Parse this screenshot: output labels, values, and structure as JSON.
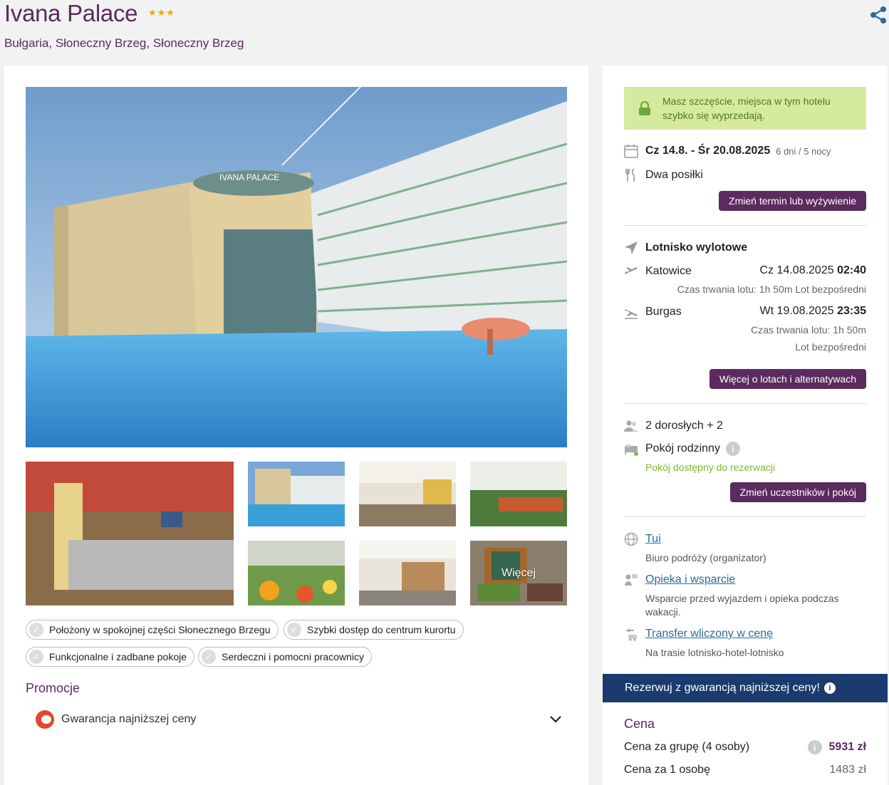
{
  "hotel": {
    "name": "Ivana Palace",
    "stars": "★★★",
    "location": "Bułgaria, Słoneczny Brzeg, Słoneczny Brzeg",
    "hero_sign": "IVANA PALACE"
  },
  "gallery": {
    "more_label": "Więcej"
  },
  "features": [
    "Położony w spokojnej części Słonecznego Brzegu",
    "Szybki dostęp do centrum kurortu",
    "Funkcjonalne i zadbane pokoje",
    "Serdeczni i pomocni pracownicy"
  ],
  "promotions": {
    "title": "Promocje",
    "item": "Gwarancja najniższej ceny"
  },
  "sidebar": {
    "alert": "Masz szczęście, miejsca w tym hotelu szybko się wyprzedają.",
    "dates": "Cz 14.8. - Śr 20.08.2025",
    "duration": "6 dni / 5 nocy",
    "board": "Dwa posiłki",
    "change_term_button": "Zmień termin lub wyżywienie",
    "departure_airport_label": "Lotnisko wylotowe",
    "outbound": {
      "city": "Katowice",
      "date": "Cz 14.08.2025",
      "time": "02:40",
      "info": "Czas trwania lotu: 1h 50m  Lot bezpośredni"
    },
    "inbound": {
      "city": "Burgas",
      "date": "Wt 19.08.2025",
      "time": "23:35",
      "duration": "Czas trwania lotu: 1h 50m",
      "direct": "Lot bezpośredni"
    },
    "flights_button": "Więcej o lotach i alternatywach",
    "travelers": "2 dorosłych + 2",
    "room": "Pokój rodzinny",
    "room_status": "Pokój dostępny do rezerwacji",
    "change_participants_button": "Zmień uczestników i pokój",
    "organizer_link": "Tui",
    "organizer_desc": "Biuro podróży (organizator)",
    "support_link": "Opieka i wsparcie",
    "support_desc": "Wsparcie przed wyjazdem i opieka podczas wakacji.",
    "transfer_link": "Transfer wliczony w cenę",
    "transfer_desc": "Na trasie lotnisko-hotel-lotnisko",
    "banner": "Rezerwuj z gwarancją najniższej ceny!",
    "price_title": "Cena",
    "group_price_label": "Cena za grupę (4 osoby)",
    "group_price_value": "5931 zł",
    "person_price_label": "Cena za 1 osobę",
    "person_price_value": "1483 zł"
  },
  "colors": {
    "brand_purple": "#5b2a5e",
    "alert_green": "#d5ea9f",
    "banner_navy": "#1b3a6e",
    "link_blue": "#2a6b9e"
  }
}
